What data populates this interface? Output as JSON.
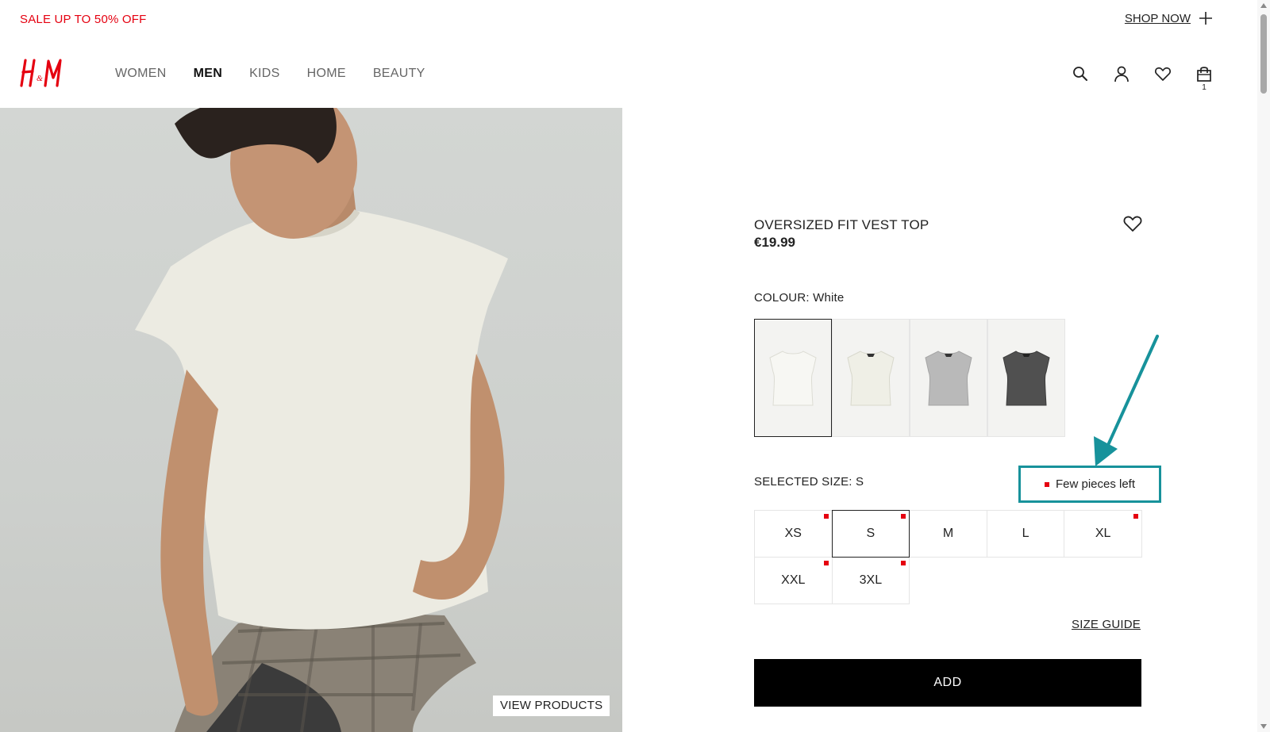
{
  "promo": {
    "text": "SALE UP TO 50% OFF",
    "cta_label": "SHOP NOW"
  },
  "brand": {
    "logo_text": "H&M",
    "color": "#e50010"
  },
  "nav": {
    "items": [
      {
        "label": "WOMEN",
        "active": false
      },
      {
        "label": "MEN",
        "active": true
      },
      {
        "label": "KIDS",
        "active": false
      },
      {
        "label": "HOME",
        "active": false
      },
      {
        "label": "BEAUTY",
        "active": false
      }
    ]
  },
  "header_icons": {
    "search": "search-icon",
    "account": "user-icon",
    "favourites": "heart-icon",
    "bag": "shopping-bag-icon",
    "bag_count": "1"
  },
  "hero": {
    "view_products_label": "VIEW PRODUCTS"
  },
  "product": {
    "name": "OVERSIZED FIT VEST TOP",
    "price": "€19.99",
    "colour_label": "COLOUR: White",
    "swatches": [
      {
        "colour": "#f6f6f2",
        "selected": true
      },
      {
        "colour": "#efefe8",
        "selected": false
      },
      {
        "colour": "#b9b9b9",
        "selected": false
      },
      {
        "colour": "#505050",
        "selected": false
      }
    ],
    "selected_size_label": "SELECTED SIZE: S",
    "stock_note": "Few pieces left",
    "sizes": [
      {
        "label": "XS",
        "low_stock": true,
        "selected": false
      },
      {
        "label": "S",
        "low_stock": true,
        "selected": true
      },
      {
        "label": "M",
        "low_stock": false,
        "selected": false
      },
      {
        "label": "L",
        "low_stock": false,
        "selected": false
      },
      {
        "label": "XL",
        "low_stock": true,
        "selected": false
      },
      {
        "label": "XXL",
        "low_stock": true,
        "selected": false
      },
      {
        "label": "3XL",
        "low_stock": true,
        "selected": false
      }
    ],
    "size_guide_label": "SIZE GUIDE",
    "add_label": "ADD"
  },
  "annotation": {
    "color": "#17929b"
  }
}
